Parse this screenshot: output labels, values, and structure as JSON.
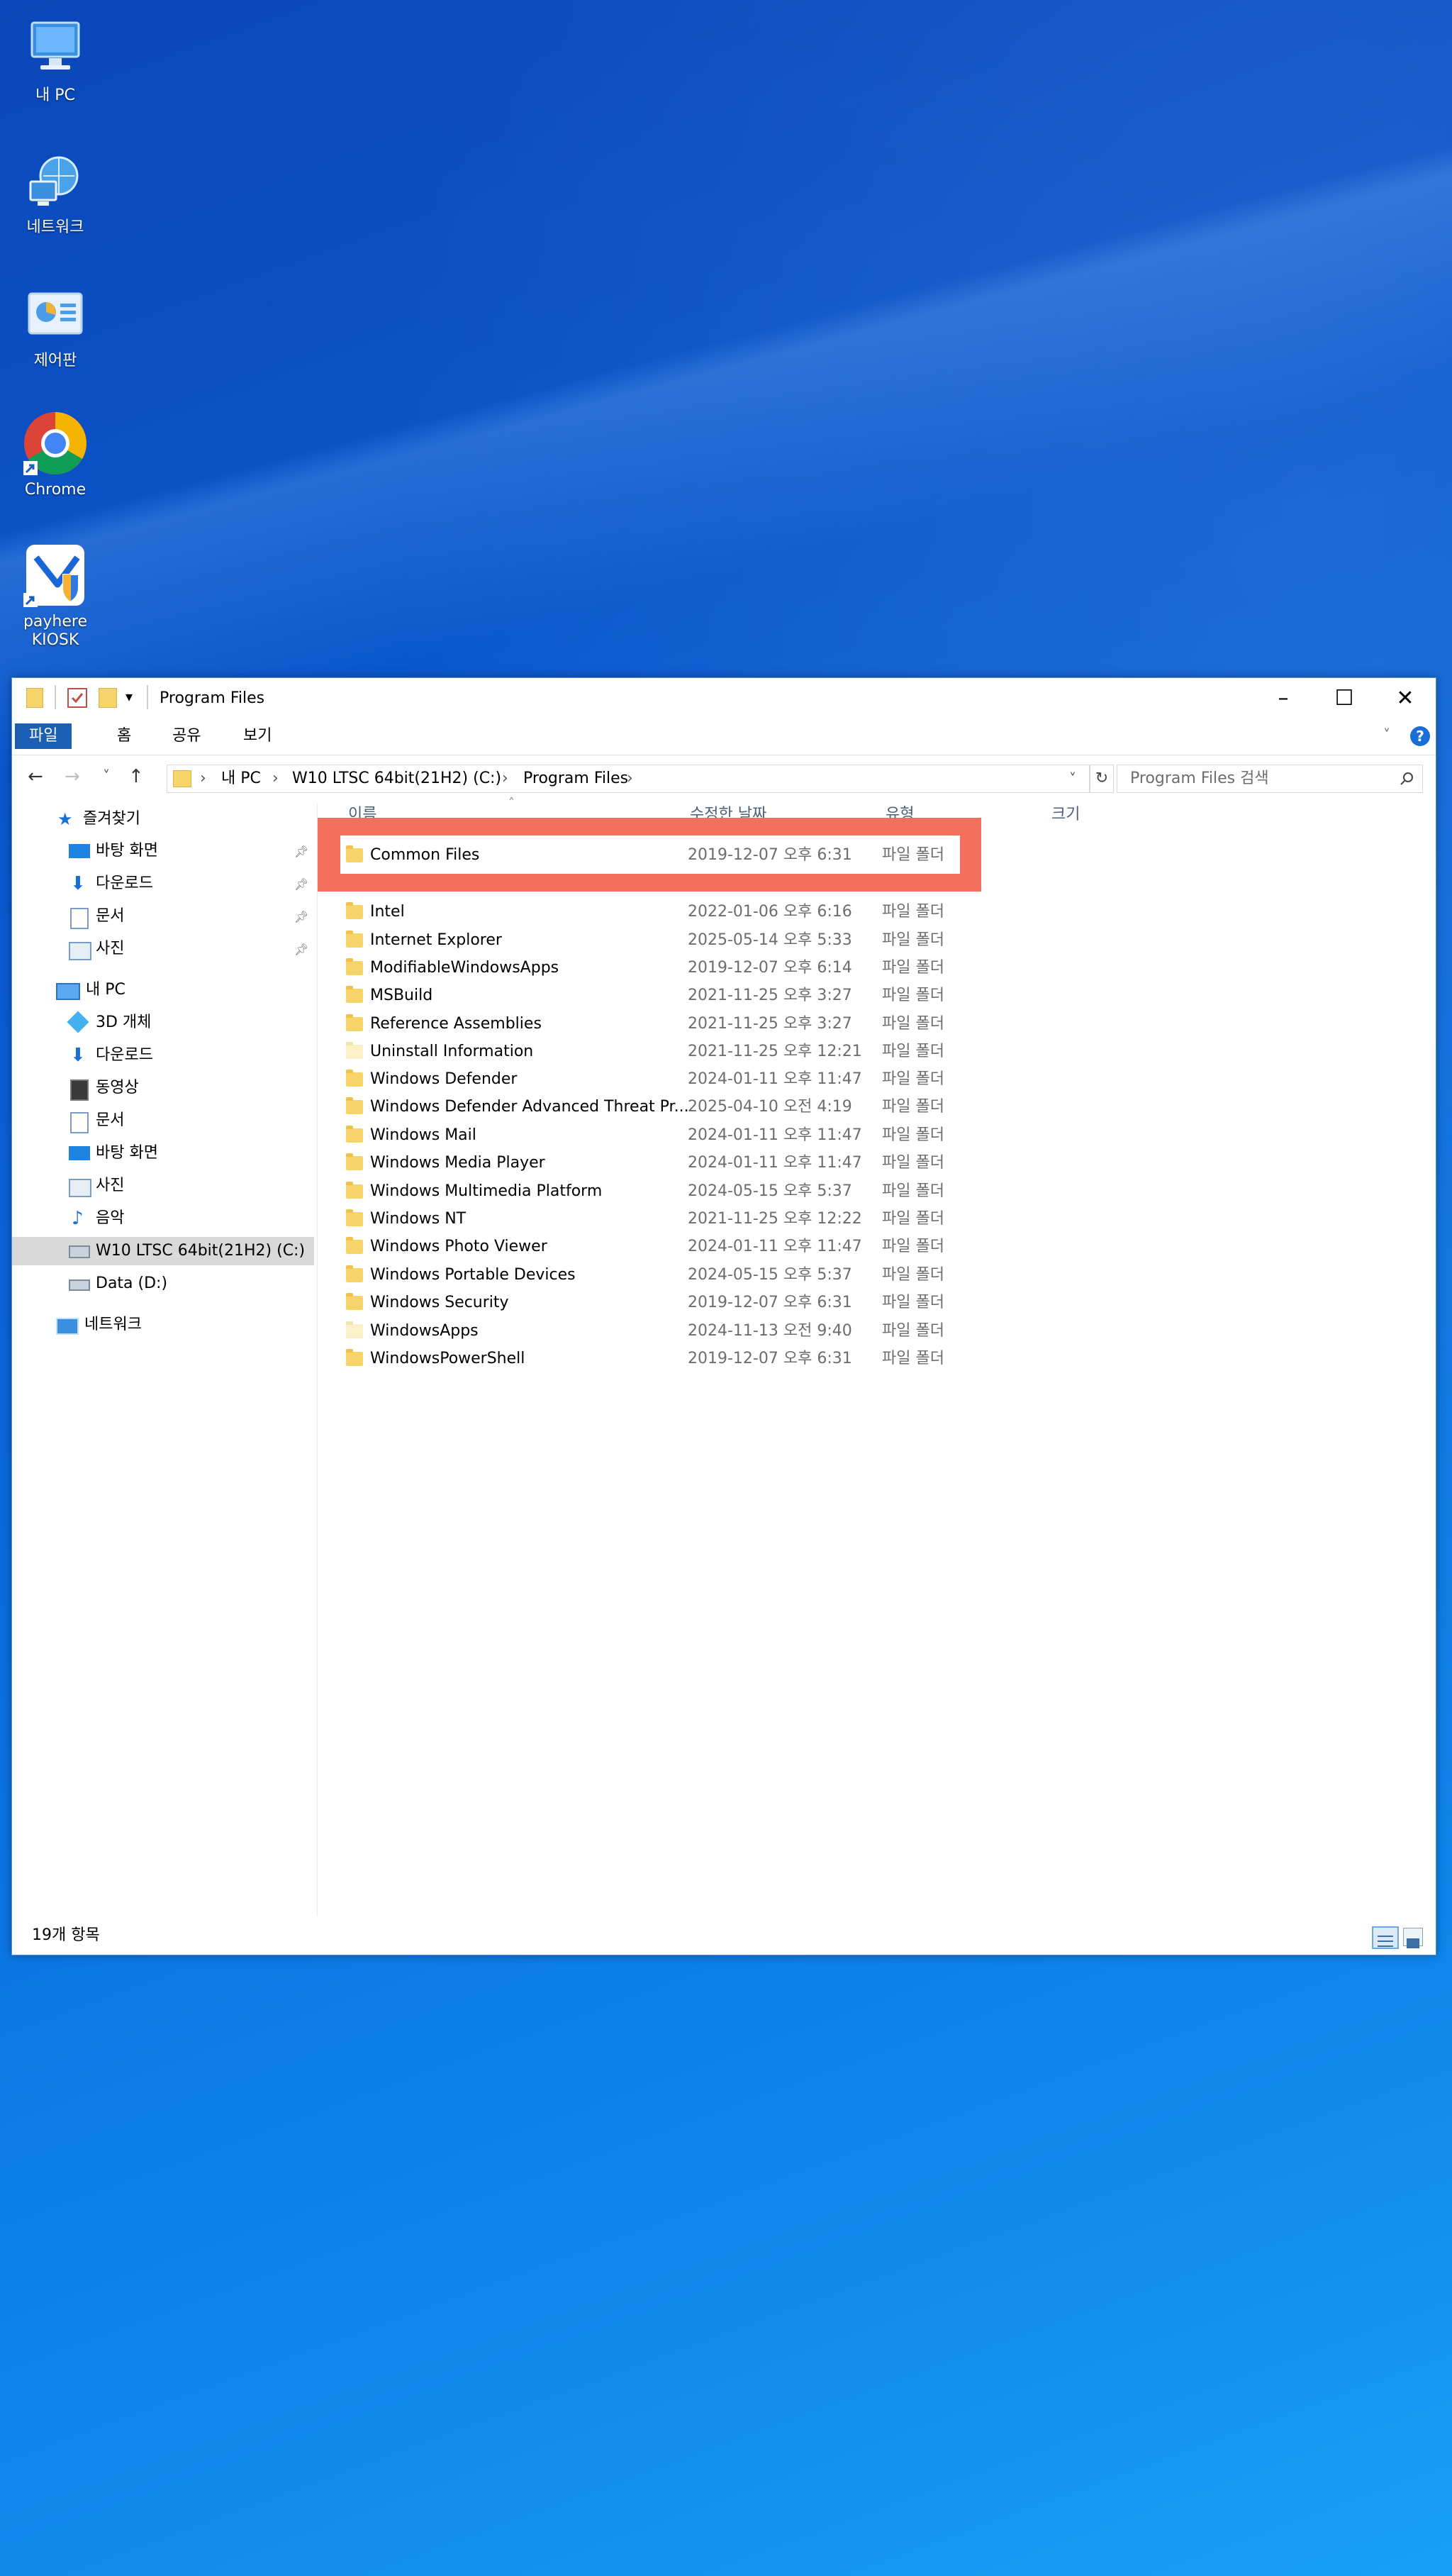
{
  "desktop": {
    "icons": [
      {
        "label": "내 PC",
        "icon": "computer-icon"
      },
      {
        "label": "네트워크",
        "icon": "network-icon"
      },
      {
        "label": "제어판",
        "icon": "control-panel-icon"
      },
      {
        "label": "Chrome",
        "icon": "chrome-icon"
      },
      {
        "label": "payhere KIOSK",
        "icon": "kiosk-icon"
      }
    ]
  },
  "window": {
    "title": "Program Files",
    "controls": {
      "minimize": "–",
      "maximize": "☐",
      "close": "✕"
    },
    "ribbon": {
      "tabs": [
        "파일",
        "홈",
        "공유",
        "보기"
      ],
      "help": "?"
    },
    "nav": {
      "back": "←",
      "forward": "→",
      "recent": "˅",
      "up": "↑",
      "breadcrumb": [
        "내 PC",
        "W10 LTSC 64bit(21H2) (C:)",
        "Program Files"
      ],
      "search_placeholder": "Program Files 검색"
    },
    "sidebar": {
      "quick_access": "즐겨찾기",
      "quick_items": [
        "바탕 화면",
        "다운로드",
        "문서",
        "사진"
      ],
      "this_pc": "내 PC",
      "pc_items": [
        "3D 개체",
        "다운로드",
        "동영상",
        "문서",
        "바탕 화면",
        "사진",
        "음악",
        "W10 LTSC 64bit(21H2) (C:)",
        "Data (D:)"
      ],
      "network": "네트워크"
    },
    "columns": {
      "name": "이름",
      "modified": "수정한 날짜",
      "type": "유형",
      "size": "크기"
    },
    "files": [
      {
        "name": "Common Files",
        "date": "2019-12-07 오후 6:31",
        "type": "파일 폴더"
      },
      {
        "name": "Intel",
        "date": "2022-01-06 오후 6:16",
        "type": "파일 폴더"
      },
      {
        "name": "Internet Explorer",
        "date": "2025-05-14 오후 5:33",
        "type": "파일 폴더"
      },
      {
        "name": "ModifiableWindowsApps",
        "date": "2019-12-07 오후 6:14",
        "type": "파일 폴더"
      },
      {
        "name": "MSBuild",
        "date": "2021-11-25 오후 3:27",
        "type": "파일 폴더"
      },
      {
        "name": "Reference Assemblies",
        "date": "2021-11-25 오후 3:27",
        "type": "파일 폴더"
      },
      {
        "name": "Uninstall Information",
        "date": "2021-11-25 오후 12:21",
        "type": "파일 폴더"
      },
      {
        "name": "Windows Defender",
        "date": "2024-01-11 오후 11:47",
        "type": "파일 폴더"
      },
      {
        "name": "Windows Defender Advanced Threat Pr...",
        "date": "2025-04-10 오전 4:19",
        "type": "파일 폴더"
      },
      {
        "name": "Windows Mail",
        "date": "2024-01-11 오후 11:47",
        "type": "파일 폴더"
      },
      {
        "name": "Windows Media Player",
        "date": "2024-01-11 오후 11:47",
        "type": "파일 폴더"
      },
      {
        "name": "Windows Multimedia Platform",
        "date": "2024-05-15 오후 5:37",
        "type": "파일 폴더"
      },
      {
        "name": "Windows NT",
        "date": "2021-11-25 오후 12:22",
        "type": "파일 폴더"
      },
      {
        "name": "Windows Photo Viewer",
        "date": "2024-01-11 오후 11:47",
        "type": "파일 폴더"
      },
      {
        "name": "Windows Portable Devices",
        "date": "2024-05-15 오후 5:37",
        "type": "파일 폴더"
      },
      {
        "name": "Windows Security",
        "date": "2019-12-07 오후 6:31",
        "type": "파일 폴더"
      },
      {
        "name": "WindowsApps",
        "date": "2024-11-13 오전 9:40",
        "type": "파일 폴더"
      },
      {
        "name": "WindowsPowerShell",
        "date": "2019-12-07 오후 6:31",
        "type": "파일 폴더"
      }
    ],
    "status": "19개 항목"
  },
  "colors": {
    "accent": "#1a5fb4",
    "highlight": "#f2705d",
    "folder": "#f7d46a"
  }
}
